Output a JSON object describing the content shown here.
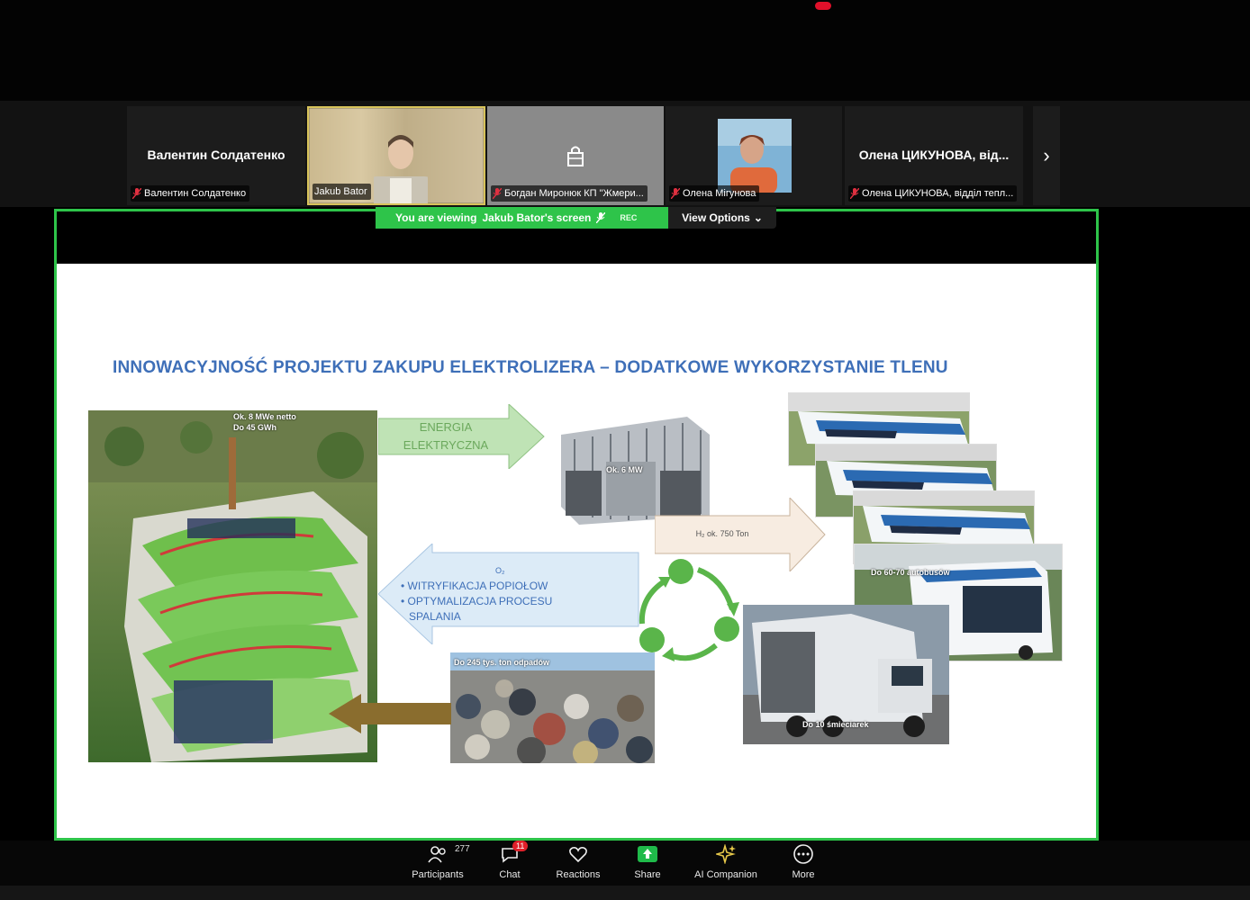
{
  "participants_strip": {
    "tiles": [
      {
        "display_name": "Валентин Солдатенко",
        "label": "Валентин Солдатенко",
        "muted": true
      },
      {
        "label": "Jakub Bator",
        "muted": false
      },
      {
        "label": "Богдан Миронюк КП \"Жмери...",
        "muted": true
      },
      {
        "label": "Олена Мігунова",
        "muted": true
      },
      {
        "display_name": "Олена ЦИКУНОВА, від...",
        "label": "Олена ЦИКУНОВА, відділ тепл...",
        "muted": true
      }
    ]
  },
  "share_banner": {
    "viewing_prefix": "You are viewing",
    "sharer": "Jakub Bator's screen",
    "rec_label": "REC",
    "view_options": "View Options"
  },
  "slide": {
    "title": "INNOWACYJNOŚĆ PROJEKTU ZAKUPU ELEKTROLIZERA – DODATKOWE WYKORZYSTANIE TLENU",
    "plant_caption_1": "Ok. 8 MWe netto",
    "plant_caption_2": "Do 45 GWh",
    "energy_arrow_line1": "ENERGIA",
    "energy_arrow_line2": "ELEKTRYCZNA",
    "electrolyzer_caption": "Ok. 6 MW",
    "h2_arrow": "H₂ ok. 750 Ton",
    "o2_label": "O₂",
    "o2_items": [
      "WITRYFIKACJA POPIOŁOW",
      "OPTYMALIZACJA PROCESU SPALANIA"
    ],
    "waste_caption": "Do 245 tys. ton odpadów",
    "buses_caption": "Do 60-70 autobusów",
    "truck_caption": "Do 10 śmieciarek"
  },
  "toolbar": {
    "participants_label": "Participants",
    "participants_count": "277",
    "chat_label": "Chat",
    "chat_badge": "11",
    "reactions_label": "Reactions",
    "share_label": "Share",
    "ai_label": "AI Companion",
    "more_label": "More"
  },
  "colors": {
    "share_green": "#2ec44a",
    "title_blue": "#3e6fb8",
    "recycle_green": "#5ab54a"
  }
}
